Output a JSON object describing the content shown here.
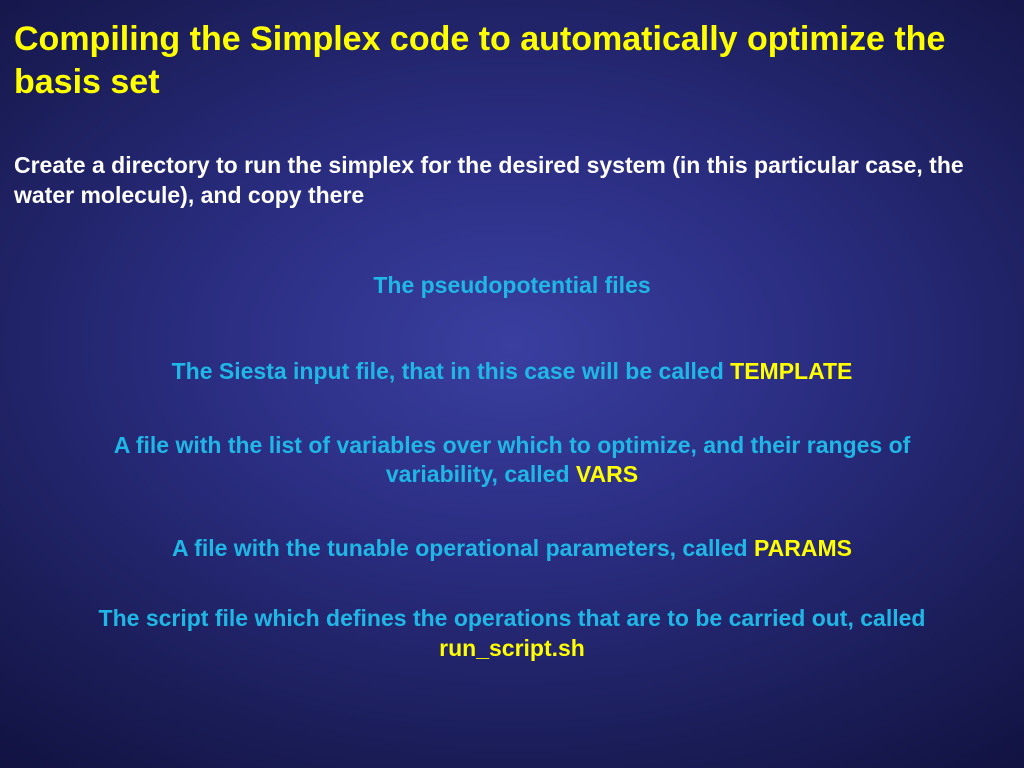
{
  "title": "Compiling the Simplex code to automatically optimize the basis set",
  "intro": "Create a directory to run the simplex for the desired system (in this particular case, the water molecule), and copy there",
  "items": {
    "i1": "The pseudopotential files",
    "i2a": "The Siesta input file, that in this case will be called ",
    "i2b": "TEMPLATE",
    "i3a": "A file with the list of variables over which to optimize, and their ranges of variability, called ",
    "i3b": "VARS",
    "i4a": "A file with the tunable operational parameters, called ",
    "i4b": "PARAMS",
    "i5a": "The script file which defines the operations that are to be carried out, called ",
    "i5b": "run_script.sh"
  }
}
